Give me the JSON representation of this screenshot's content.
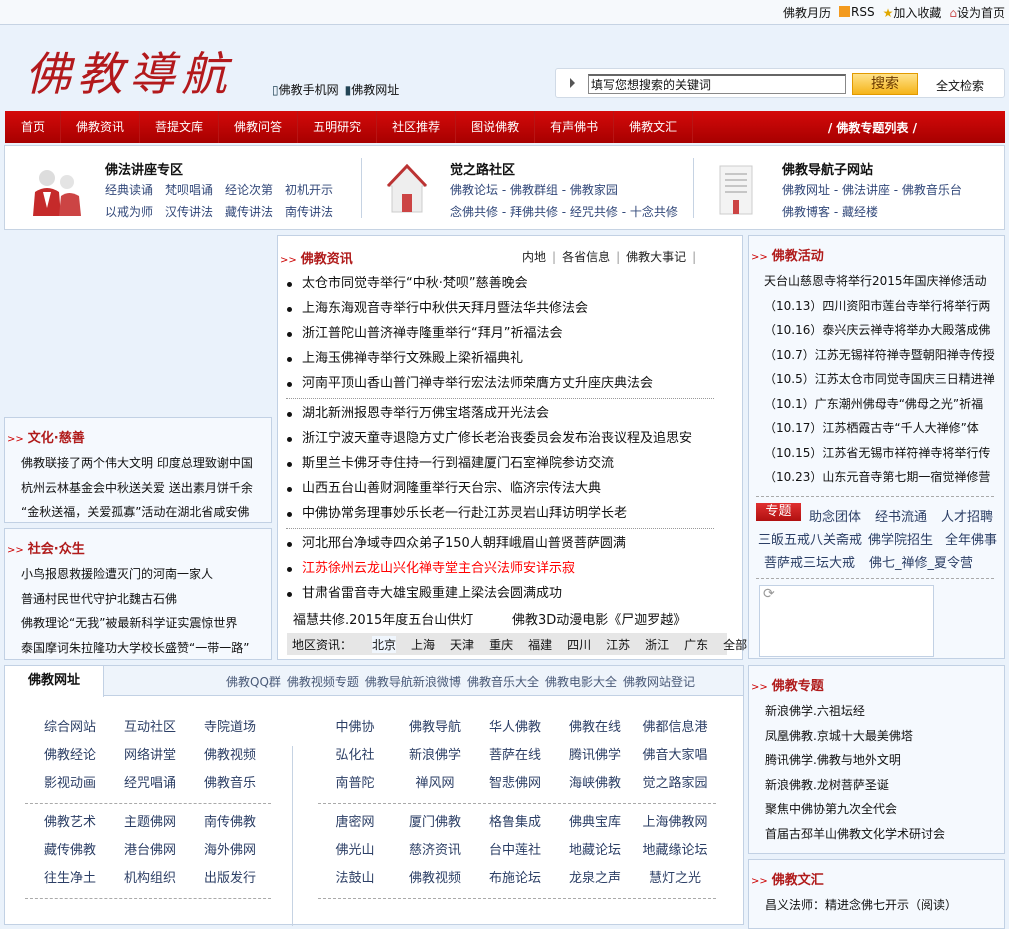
{
  "topbar": {
    "calendar": "佛教月历",
    "rss": "RSS",
    "favorite": "加入收藏",
    "homepage": "设为首页"
  },
  "header": {
    "logo": "佛教導航",
    "mobile": "佛教手机网",
    "sites": "佛教网址",
    "search_placeholder": "填写您想搜索的关键词",
    "search_btn": "搜索",
    "fulltext": "全文检索"
  },
  "nav": {
    "items": [
      "首页",
      "佛教资讯",
      "菩提文库",
      "佛教问答",
      "五明研究",
      "社区推荐",
      "图说佛教",
      "有声佛书",
      "佛教文汇"
    ],
    "special": "/ 佛教专题列表 /"
  },
  "feature": [
    {
      "title": "佛法讲座专区",
      "r1": "经典读诵　梵呗唱诵　经论次第　初机开示",
      "r2": "以戒为师　汉传讲法　藏传讲法　南传讲法"
    },
    {
      "title": "觉之路社区",
      "r1": "佛教论坛 - 佛教群组 - 佛教家园",
      "r2": "念佛共修 - 拜佛共修 - 经咒共修 - 十念共修"
    },
    {
      "title": "佛教导航子网站",
      "r1": "佛教网址 - 佛法讲座 - 佛教音乐台",
      "r2": "佛教博客 - 藏经楼"
    }
  ],
  "culture": {
    "title": "文化·慈善",
    "items": [
      "佛教联接了两个伟大文明 印度总理致谢中国",
      "杭州云林基金会中秋送关爱 送出素月饼千余",
      "“金秋送福，关爱孤寡”活动在湖北省咸安佛"
    ]
  },
  "society": {
    "title": "社会·众生",
    "items": [
      "小鸟报恩救援险遭灭门的河南一家人",
      "普通村民世代守护北魏古石佛",
      "佛教理论“无我”被最新科学证实震惊世界",
      "泰国摩诃朱拉隆功大学校长盛赞“一带一路”"
    ]
  },
  "news": {
    "title": "佛教资讯",
    "tabs": [
      "内地",
      "各省信息",
      "佛教大事记"
    ],
    "group1": [
      "太仓市同觉寺举行“中秋·梵呗”慈善晚会",
      "上海东海观音寺举行中秋供天拜月暨法华共修法会",
      "浙江普陀山普济禅寺隆重举行“拜月”祈福法会",
      "上海玉佛禅寺举行文殊殿上梁祈福典礼",
      "河南平顶山香山普门禅寺举行宏法法师荣膺方丈升座庆典法会"
    ],
    "group2": [
      "湖北新洲报恩寺举行万佛宝塔落成开光法会",
      "浙江宁波天童寺退隐方丈广修长老治丧委员会发布治丧议程及追思安",
      "斯里兰卡佛牙寺住持一行到福建厦门石室禅院参访交流",
      "山西五台山善财洞隆重举行天台宗、临济宗传法大典",
      "中佛协常务理事妙乐长老一行赴江苏灵岩山拜访明学长老"
    ],
    "group3": [
      "河北邢台净域寺四众弟子150人朝拜峨眉山普贤菩萨圆满",
      "江苏徐州云龙山兴化禅寺堂主合兴法师安详示寂",
      "甘肃省雷音寺大雄宝殿重建上梁法会圆满成功"
    ],
    "highlight_index": 1,
    "extra": [
      "福慧共修.2015年度五台山供灯",
      "佛教3D动漫电影《尸迦罗越》"
    ],
    "region_label": "地区资讯：",
    "regions": [
      "北京",
      "上海",
      "天津",
      "重庆",
      "福建",
      "四川",
      "江苏",
      "浙江",
      "广东",
      "全部"
    ]
  },
  "activity": {
    "title": "佛教活动",
    "items": [
      "天台山慈恩寺将举行2015年国庆禅修活动",
      "（10.13）四川资阳市莲台寺举行将举行两",
      "（10.16）泰兴庆云禅寺将举办大殿落成佛",
      "（10.7）江苏无锡祥符禅寺暨朝阳禅寺传授",
      "（10.5）江苏太仓市同觉寺国庆三日精进禅",
      "（10.1）广东潮州佛母寺“佛母之光”祈福",
      "（10.17）江苏栖霞古寺“千人大禅修”体",
      "（10.15）江苏省无锡市祥符禅寺将举行传",
      "（10.23）山东元音寺第七期一宿觉禅修营"
    ],
    "topic_badge": "专题",
    "topics": [
      "助念团体",
      "经书流通",
      "人才招聘",
      "三皈五戒八关斋戒",
      "佛学院招生",
      "全年佛事",
      "菩萨戒三坛大戒",
      "佛七_禅修_夏令营"
    ]
  },
  "sites": {
    "tab": "佛教网址",
    "toplinks": [
      "佛教QQ群",
      "佛教视频专题",
      "佛教导航新浪微博",
      "佛教音乐大全",
      "佛教电影大全",
      "佛教网站登记"
    ],
    "left1": [
      "综合网站",
      "互动社区",
      "寺院道场",
      "佛教经论",
      "网络讲堂",
      "佛教视频",
      "影视动画",
      "经咒唱诵",
      "佛教音乐"
    ],
    "left2": [
      "佛教艺术",
      "主题佛网",
      "南传佛教",
      "藏传佛教",
      "港台佛网",
      "海外佛网",
      "往生净土",
      "机构组织",
      "出版发行"
    ],
    "right1": [
      "中佛协",
      "佛教导航",
      "华人佛教",
      "佛教在线",
      "佛都信息港",
      "弘化社",
      "新浪佛学",
      "菩萨在线",
      "腾讯佛学",
      "佛音大家唱",
      "南普陀",
      "禅风网",
      "智悲佛网",
      "海峡佛教",
      "觉之路家园"
    ],
    "right2": [
      "唐密网",
      "厦门佛教",
      "格鲁集成",
      "佛典宝库",
      "上海佛教网",
      "佛光山",
      "慈济资讯",
      "台中莲社",
      "地藏论坛",
      "地藏缘论坛",
      "法鼓山",
      "佛教视频",
      "布施论坛",
      "龙泉之声",
      "慧灯之光"
    ]
  },
  "topics": {
    "title": "佛教专题",
    "items": [
      "新浪佛学.六祖坛经",
      "凤凰佛教.京城十大最美佛塔",
      "腾讯佛学.佛教与地外文明",
      "新浪佛教.龙树菩萨圣诞",
      "聚焦中佛协第九次全代会",
      "首届古邳羊山佛教文化学术研讨会"
    ]
  },
  "writings": {
    "title": "佛教文汇",
    "items": [
      "昌义法师：精进念佛七开示（阅读）"
    ]
  },
  "colors": {
    "accent": "#b01b1b",
    "nav": "#c00000",
    "link": "#2c3f66"
  }
}
